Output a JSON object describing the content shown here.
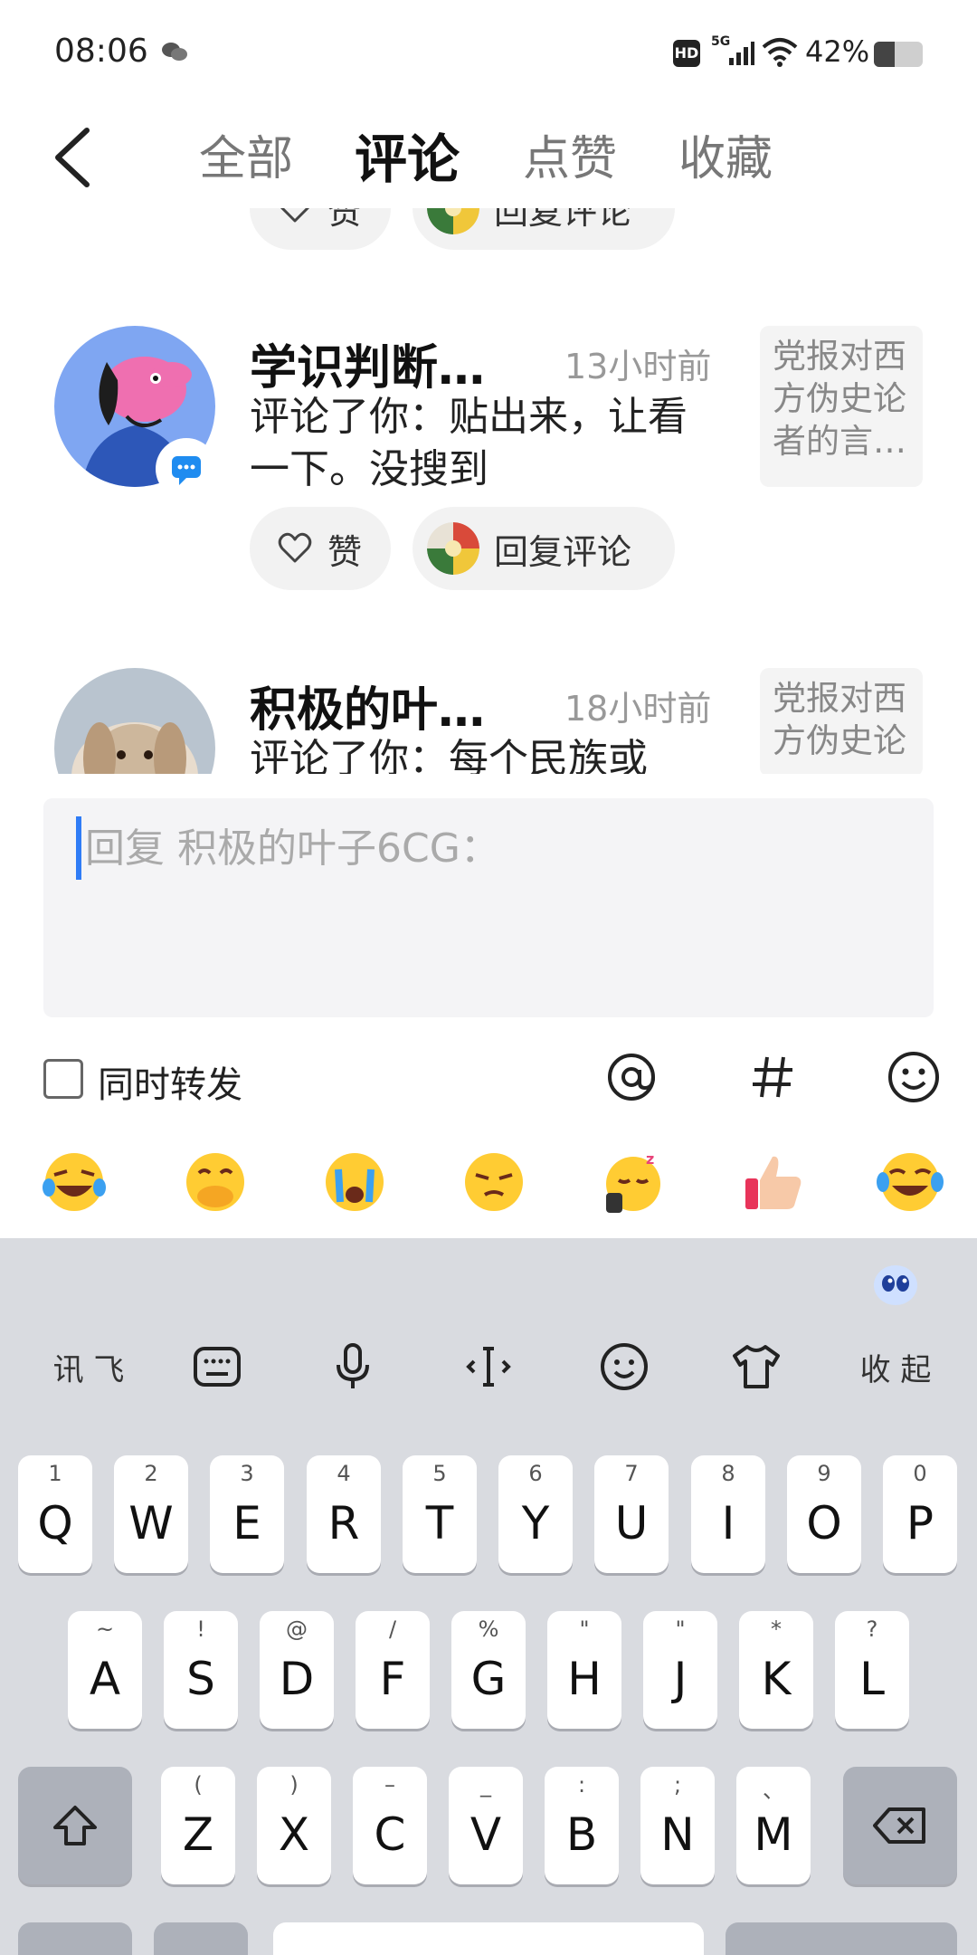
{
  "status": {
    "time": "08:06",
    "hd": "HD",
    "network": "5G",
    "battery_text": "42%",
    "battery_level": 0.42
  },
  "nav": {
    "tabs": [
      {
        "label": "全部"
      },
      {
        "label": "评论"
      },
      {
        "label": "点赞"
      },
      {
        "label": "收藏"
      }
    ]
  },
  "actions": {
    "like_label": "赞",
    "reply_label": "回复评论"
  },
  "comments": [
    {
      "name": "学识判断…",
      "time": "13小时前",
      "text": "评论了你：贴出来，让看一下。没搜到",
      "ref": "党报对西方伪史论者的言…"
    },
    {
      "name": "积极的叶…",
      "time": "18小时前",
      "text": "评论了你：每个民族或",
      "ref": "党报对西方伪史论"
    }
  ],
  "reply": {
    "placeholder": "回复 积极的叶子6CG："
  },
  "options": {
    "forward_label": "同时转发"
  },
  "keyboard": {
    "toolbar": {
      "brand": "讯 飞",
      "collapse": "收 起"
    },
    "rows": [
      [
        {
          "main": "Q",
          "sub": "1"
        },
        {
          "main": "W",
          "sub": "2"
        },
        {
          "main": "E",
          "sub": "3"
        },
        {
          "main": "R",
          "sub": "4"
        },
        {
          "main": "T",
          "sub": "5"
        },
        {
          "main": "Y",
          "sub": "6"
        },
        {
          "main": "U",
          "sub": "7"
        },
        {
          "main": "I",
          "sub": "8"
        },
        {
          "main": "O",
          "sub": "9"
        },
        {
          "main": "P",
          "sub": "0"
        }
      ],
      [
        {
          "main": "A",
          "sub": "~"
        },
        {
          "main": "S",
          "sub": "!"
        },
        {
          "main": "D",
          "sub": "@"
        },
        {
          "main": "F",
          "sub": "/"
        },
        {
          "main": "G",
          "sub": "%"
        },
        {
          "main": "H",
          "sub": "\""
        },
        {
          "main": "J",
          "sub": "\""
        },
        {
          "main": "K",
          "sub": "*"
        },
        {
          "main": "L",
          "sub": "?"
        }
      ],
      [
        {
          "main": "Z",
          "sub": "("
        },
        {
          "main": "X",
          "sub": ")"
        },
        {
          "main": "C",
          "sub": "–"
        },
        {
          "main": "V",
          "sub": "_"
        },
        {
          "main": "B",
          "sub": ":"
        },
        {
          "main": "N",
          "sub": ";"
        },
        {
          "main": "M",
          "sub": "、"
        }
      ]
    ]
  }
}
